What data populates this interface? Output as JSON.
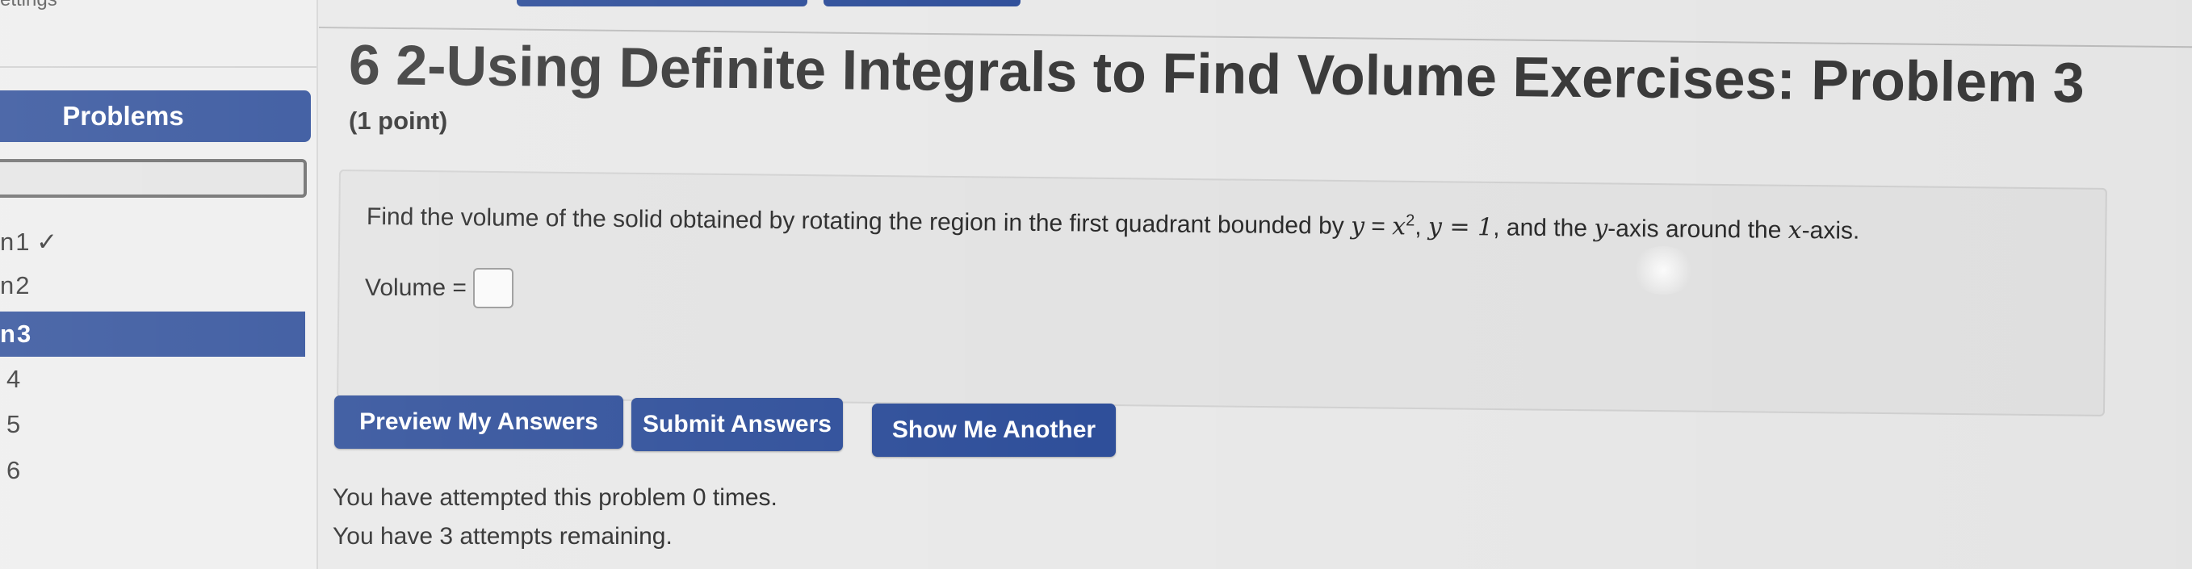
{
  "sidebar": {
    "settings_label": "ettings",
    "problems_header": "Problems",
    "items": [
      {
        "label": "1 ✓",
        "prefix": "n"
      },
      {
        "label": "2",
        "prefix": "n"
      },
      {
        "label": "3",
        "prefix": "n"
      },
      {
        "label": "4",
        "prefix": ""
      },
      {
        "label": "5",
        "prefix": ""
      },
      {
        "label": "6",
        "prefix": ""
      }
    ]
  },
  "main": {
    "title": "6 2-Using Definite Integrals to Find Volume Exercises: Problem 3",
    "points": "(1 point)",
    "problem": {
      "intro": "Find the volume of the solid obtained by rotating the region in the first quadrant bounded by",
      "eq1_lhs": "y",
      "eq1_rhs": "x",
      "eq1_exp": "2",
      "eq2": "y = 1",
      "and_the": ", and the",
      "axis1": "y",
      "around_the": "-axis around the",
      "axis2": "x",
      "end": "-axis.",
      "volume_label": "Volume =",
      "volume_value": ""
    },
    "buttons": {
      "preview": "Preview My Answers",
      "submit": "Submit Answers",
      "another": "Show Me Another"
    },
    "attempts": {
      "line1": "You have attempted this problem 0 times.",
      "line2": "You have 3 attempts remaining."
    }
  },
  "colors": {
    "accent": "#2f4f9a",
    "background": "#e9e9e9",
    "panel": "#e3e3e3"
  }
}
